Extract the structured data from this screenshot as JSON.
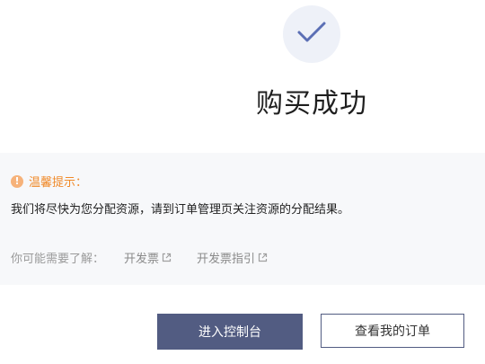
{
  "success": {
    "title": "购买成功",
    "icon": "checkmark-icon"
  },
  "notice": {
    "tip_title": "温馨提示：",
    "tip_icon": "warning-icon",
    "tip_text": "我们将尽快为您分配资源，请到订单管理页关注资源的分配结果。",
    "learn_label": "你可能需要了解：",
    "links": [
      {
        "label": "开发票",
        "icon": "external-link-icon"
      },
      {
        "label": "开发票指引",
        "icon": "external-link-icon"
      }
    ]
  },
  "actions": {
    "console_label": "进入控制台",
    "orders_label": "查看我的订单"
  },
  "colors": {
    "accent": "#525c82",
    "check": "#5b6fb5",
    "warning": "#f08a2a",
    "circle_bg": "#eef1f8",
    "notice_bg": "#f7f8fa"
  }
}
